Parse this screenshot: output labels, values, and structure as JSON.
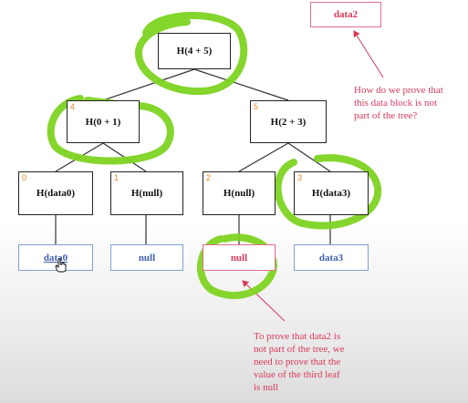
{
  "tree": {
    "root": {
      "label": "H(4 + 5)"
    },
    "level1": [
      {
        "index": "4",
        "label": "H(0 + 1)"
      },
      {
        "index": "5",
        "label": "H(2 + 3)"
      }
    ],
    "level2": [
      {
        "index": "0",
        "label": "H(data0)"
      },
      {
        "index": "1",
        "label": "H(null)"
      },
      {
        "index": "2",
        "label": "H(null)"
      },
      {
        "index": "3",
        "label": "H(data3)"
      }
    ],
    "leaves": [
      "data0",
      "null",
      "null",
      "data3"
    ]
  },
  "outside_block": {
    "label": "data2"
  },
  "notes": {
    "question": "How do we prove that\nthis data block is not\npart of the tree?",
    "answer": "To prove that data2 is\nnot part of the tree, we\nneed to prove that the\nvalue of the third leaf\nis null"
  },
  "colors": {
    "highlight": "#7ed321",
    "annotation": "#d83a5a",
    "index_label": "#e08a2a",
    "leaf_text": "#3f5fb0"
  }
}
